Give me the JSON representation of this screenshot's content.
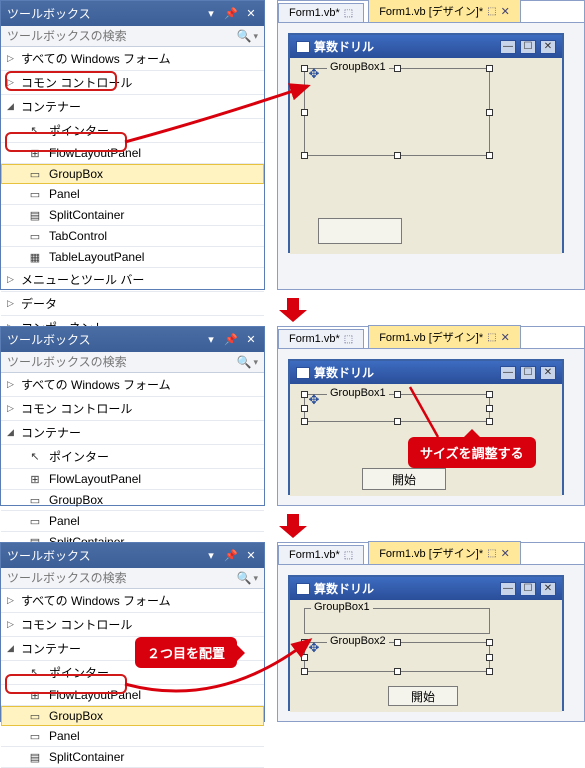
{
  "toolbox": {
    "title": "ツールボックス",
    "search_placeholder": "ツールボックスの検索"
  },
  "cats": {
    "all_windows_forms": "すべての Windows フォーム",
    "common_controls": "コモン コントロール",
    "containers": "コンテナー",
    "menus_toolbars": "メニューとツール バー",
    "data": "データ",
    "components": "コンポーネント"
  },
  "items": {
    "pointer": "ポインター",
    "flowlayout": "FlowLayoutPanel",
    "groupbox": "GroupBox",
    "panel": "Panel",
    "splitcontainer": "SplitContainer",
    "tabcontrol": "TabControl",
    "tablelayout": "TableLayoutPanel"
  },
  "designer": {
    "tab_code": "Form1.vb*",
    "tab_design": "Form1.vb [デザイン]*",
    "form_title": "算数ドリル",
    "groupbox1": "GroupBox1",
    "groupbox2": "GroupBox2",
    "start_button": "開始"
  },
  "callouts": {
    "resize": "サイズを調整する",
    "second": "２つ目を配置"
  }
}
